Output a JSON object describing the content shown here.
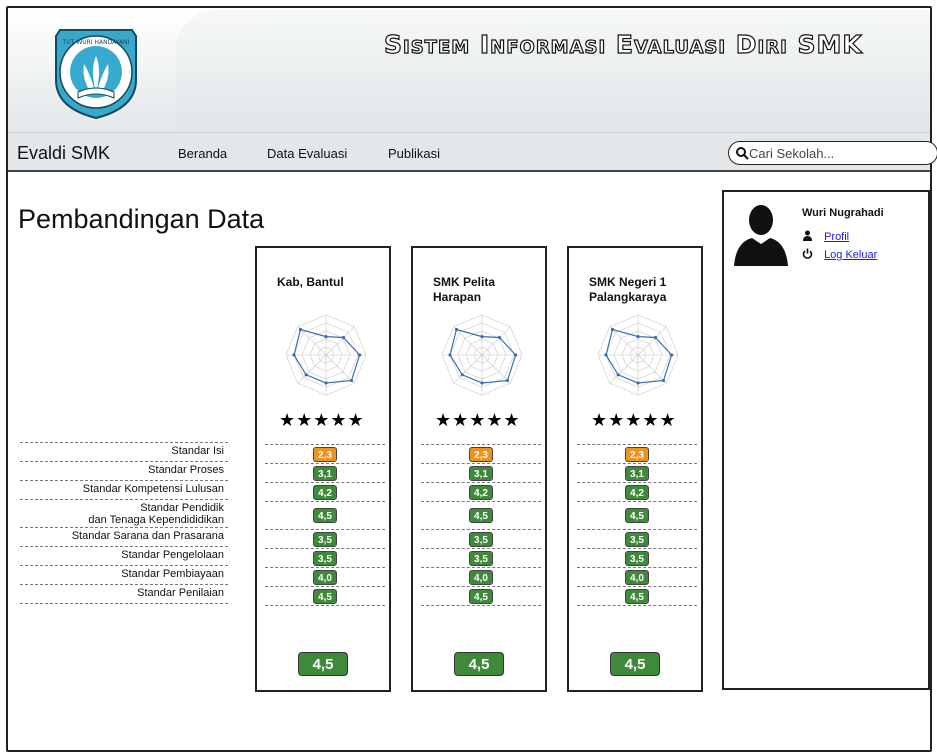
{
  "app_title": "Sistem Informasi Evaluasi Diri SMK",
  "logo_text": "TUT WURI HANDAYANI",
  "nav": {
    "brand": "Evaldi SMK",
    "links": [
      "Beranda",
      "Data Evaluasi",
      "Publikasi"
    ],
    "search_placeholder": "Cari Sekolah..."
  },
  "page_title": "Pembandingan Data",
  "standards": [
    "Standar Isi",
    "Standar Proses",
    "Standar Kompetensi Lulusan",
    "Standar Pendidik dan Tenaga Kependididikan",
    "Standar Sarana dan Prasarana",
    "Standar Pengelolaan",
    "Standar Pembiayaan",
    "Standar Penilaian"
  ],
  "standard_label_lines": {
    "line1": "Standar Pendidik",
    "line2": "dan Tenaga Kependididikan"
  },
  "columns": [
    {
      "title": "Kab, Bantul",
      "rating_stars": 5,
      "stars_text": "★★★★★",
      "scores": [
        "2,3",
        "3,1",
        "4,2",
        "4,5",
        "3,5",
        "3,5",
        "4,0",
        "4,5"
      ],
      "total": "4,5"
    },
    {
      "title": "SMK Pelita Harapan",
      "rating_stars": 5,
      "stars_text": "★★★★★",
      "scores": [
        "2,3",
        "3,1",
        "4,2",
        "4,5",
        "3,5",
        "3,5",
        "4,0",
        "4,5"
      ],
      "total": "4,5"
    },
    {
      "title": "SMK Negeri 1 Palangkaraya",
      "rating_stars": 5,
      "stars_text": "★★★★★",
      "scores": [
        "2,3",
        "3,1",
        "4,2",
        "4,5",
        "3,5",
        "3,5",
        "4,0",
        "4,5"
      ],
      "total": "4,5"
    }
  ],
  "user": {
    "name": "Wuri Nugrahadi",
    "profile_link": "Profil",
    "logout_link": "Log Keluar",
    "profile_icon": "user-icon",
    "logout_icon": "power-icon"
  },
  "colors": {
    "score_low": "#f0921e",
    "score_high": "#3f8a3a",
    "link": "#1a1aee",
    "radar_line": "#3a6fb0"
  }
}
